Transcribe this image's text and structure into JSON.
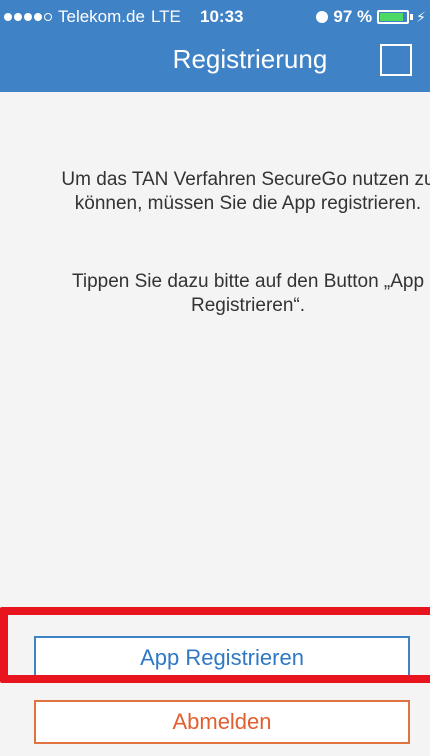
{
  "status_bar": {
    "carrier": "Telekom.de",
    "network": "LTE",
    "time": "10:33",
    "battery_percent": "97 %",
    "battery_level": 0.97
  },
  "header": {
    "title": "Registrierung"
  },
  "content": {
    "message_line1": "Um das TAN Verfahren SecureGo nutzen zu können, müssen Sie die App registrieren.",
    "message_line2": "Tippen Sie dazu bitte auf den Button „App Registrieren“."
  },
  "buttons": {
    "register_label": "App Registrieren",
    "logout_label": "Abmelden"
  },
  "colors": {
    "header": "#3f82c6",
    "register": "#2f78c4",
    "logout": "#e06030",
    "highlight": "#e8141e"
  }
}
